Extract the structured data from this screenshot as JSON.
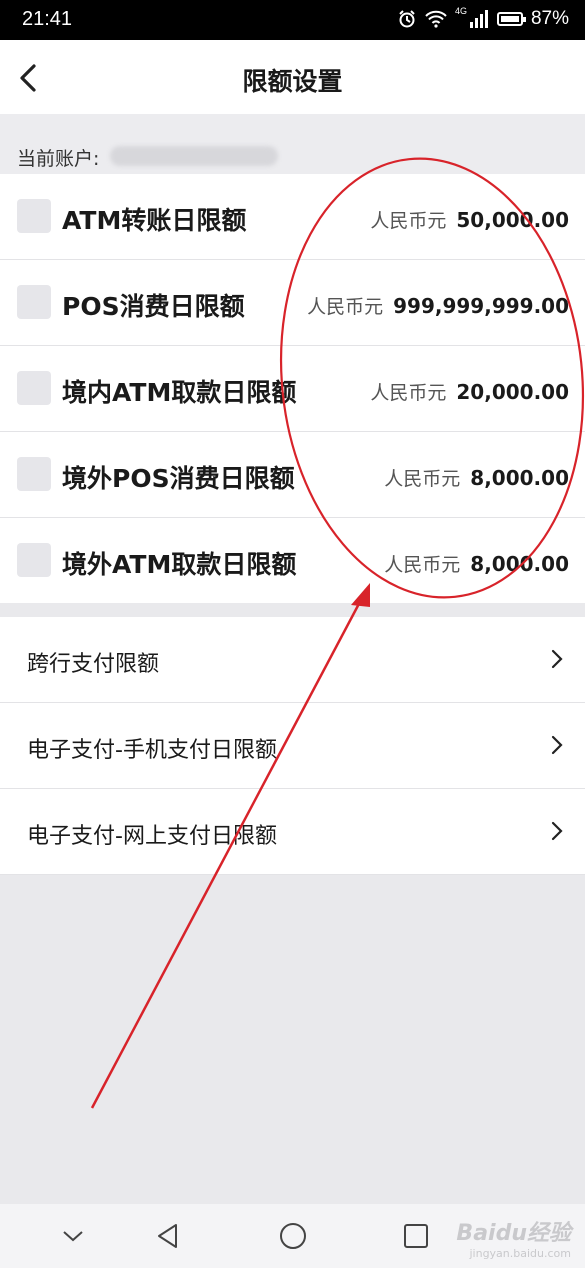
{
  "status_bar": {
    "time": "21:41",
    "battery": "87%",
    "network": "4G"
  },
  "header": {
    "title": "限额设置"
  },
  "account": {
    "label": "当前账户:"
  },
  "limits": [
    {
      "name": "ATM转账日限额",
      "currency": "人民币元",
      "amount": "50,000.00"
    },
    {
      "name": "POS消费日限额",
      "currency": "人民币元",
      "amount": "999,999,999.00"
    },
    {
      "name": "境内ATM取款日限额",
      "currency": "人民币元",
      "amount": "20,000.00"
    },
    {
      "name": "境外POS消费日限额",
      "currency": "人民币元",
      "amount": "8,000.00"
    },
    {
      "name": "境外ATM取款日限额",
      "currency": "人民币元",
      "amount": "8,000.00"
    }
  ],
  "links": [
    {
      "label": "跨行支付限额"
    },
    {
      "label": "电子支付-手机支付日限额"
    },
    {
      "label": "电子支付-网上支付日限额"
    }
  ],
  "watermark": {
    "brand": "Baidu经验",
    "url": "jingyan.baidu.com"
  },
  "annotation_color": "#d8232a"
}
